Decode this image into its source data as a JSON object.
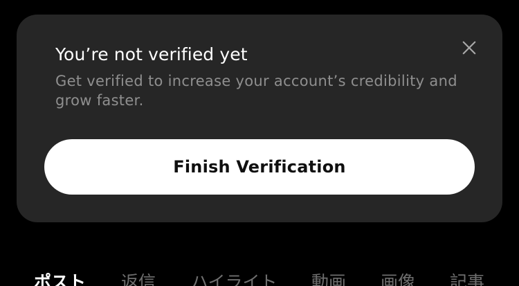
{
  "banner": {
    "title": "You’re not verified yet",
    "description": "Get verified to increase your account’s credibility and grow faster.",
    "close_icon": "close-icon",
    "button_label": "Finish Verification"
  },
  "tabs": [
    {
      "label": "ポスト",
      "active": true
    },
    {
      "label": "返信",
      "active": false
    },
    {
      "label": "ハイライト",
      "active": false
    },
    {
      "label": "動画",
      "active": false
    },
    {
      "label": "画像",
      "active": false
    },
    {
      "label": "記事",
      "active": false
    }
  ],
  "colors": {
    "background": "#000000",
    "card": "#262626",
    "title_text": "#ffffff",
    "description_text": "#8f8f8f",
    "button_bg": "#ffffff",
    "button_text": "#0f0f0f",
    "tab_active": "#ffffff",
    "tab_inactive": "#6e6e6e"
  }
}
